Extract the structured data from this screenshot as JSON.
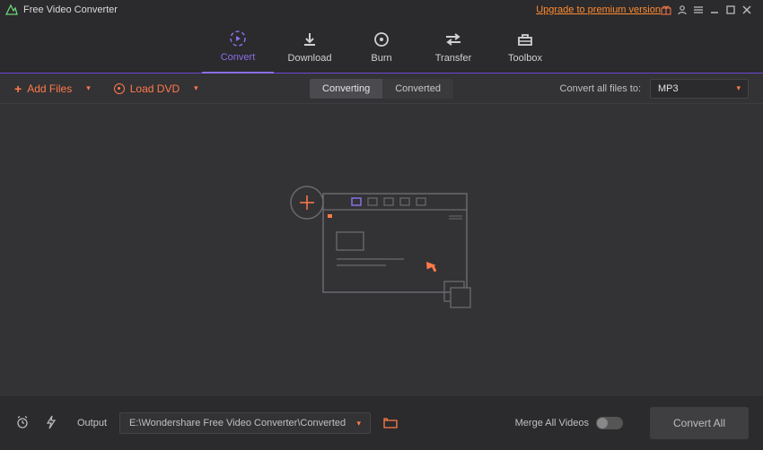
{
  "titlebar": {
    "title": "Free Video Converter",
    "upgrade": "Upgrade to premium version"
  },
  "tabs": {
    "convert": "Convert",
    "download": "Download",
    "burn": "Burn",
    "transfer": "Transfer",
    "toolbox": "Toolbox"
  },
  "subbar": {
    "add_files": "Add Files",
    "load_dvd": "Load DVD",
    "converting": "Converting",
    "converted": "Converted",
    "convert_all_to": "Convert all files to:",
    "format": "MP3"
  },
  "footer": {
    "output_label": "Output",
    "output_path": "E:\\Wondershare Free Video Converter\\Converted",
    "merge_label": "Merge All Videos",
    "convert_all": "Convert All"
  }
}
